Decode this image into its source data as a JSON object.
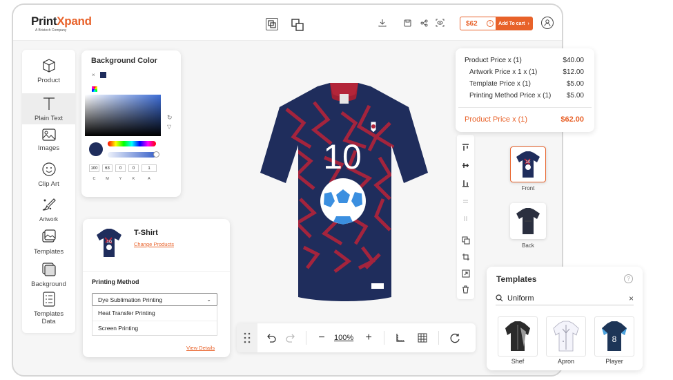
{
  "brand": {
    "name_part1": "Print",
    "name_part2": "Xpand",
    "tagline": "A Bristech Company"
  },
  "header": {
    "price": "$62",
    "add_to_cart": "Add To cart"
  },
  "sidebar": {
    "items": [
      {
        "label": "Product",
        "icon": "cube-icon"
      },
      {
        "label": "Plain Text",
        "icon": "text-icon"
      },
      {
        "label": "Images",
        "icon": "image-icon"
      },
      {
        "label": "Clip Art",
        "icon": "smiley-icon"
      },
      {
        "label": "Artwork",
        "icon": "artwork-icon"
      },
      {
        "label": "Templates",
        "icon": "templates-icon"
      },
      {
        "label": "Background",
        "icon": "background-icon"
      },
      {
        "label": "Templates\nData",
        "icon": "templates-data-icon"
      }
    ]
  },
  "background_color": {
    "title": "Background Color",
    "swatch": "#1f2d5c",
    "cmyk": {
      "c": "100",
      "m": "63",
      "y": "0",
      "k": "0",
      "a": "1"
    },
    "labels": {
      "c": "C",
      "m": "M",
      "y": "Y",
      "k": "K",
      "a": "A"
    }
  },
  "product": {
    "name": "T-Shirt",
    "change_link": "Change Products",
    "printing_method_label": "Printing Method",
    "selected_method": "Dye Sublimation Printing",
    "options": [
      "Heat Transfer Printing",
      "Screen Printing"
    ],
    "view_details": "View Details"
  },
  "jersey": {
    "number": "10",
    "color_main": "#1f2d5c",
    "color_accent": "#b3243a"
  },
  "price_popup": {
    "rows": [
      {
        "label": "Product Price x (1)",
        "value": "$40.00"
      },
      {
        "label": "Artwork Price x 1 x (1)",
        "value": "$12.00"
      },
      {
        "label": "Template Price x (1)",
        "value": "$5.00"
      },
      {
        "label": "Printing Method Price x (1)",
        "value": "$5.00"
      }
    ],
    "total_label": "Product Price x (1)",
    "total_value": "$62.00"
  },
  "views": [
    {
      "label": "Front"
    },
    {
      "label": "Back"
    }
  ],
  "bottom_toolbar": {
    "zoom": "100%"
  },
  "templates": {
    "title": "Templates",
    "search_value": "Uniform",
    "items": [
      {
        "label": "Shef"
      },
      {
        "label": "Apron"
      },
      {
        "label": "Player"
      }
    ]
  },
  "colors": {
    "accent": "#e8622a",
    "navy": "#1f2d5c"
  }
}
